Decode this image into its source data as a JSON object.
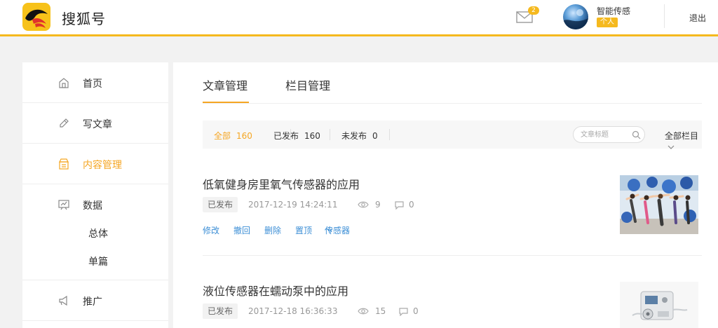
{
  "header": {
    "brand": "搜狐号",
    "mail_badge": "2",
    "user_name": "智能传感",
    "user_tag": "个人",
    "logout": "退出",
    "accent_color": "#f5b91e"
  },
  "sidebar": {
    "items": [
      {
        "label": "首页",
        "icon": "home-icon"
      },
      {
        "label": "写文章",
        "icon": "pencil-icon"
      },
      {
        "label": "内容管理",
        "icon": "content-box-icon",
        "active": true
      },
      {
        "label": "数据",
        "icon": "chart-board-icon",
        "children": [
          "总体",
          "单篇"
        ]
      },
      {
        "label": "推广",
        "icon": "megaphone-icon"
      }
    ]
  },
  "main": {
    "tabs": [
      "文章管理",
      "栏目管理"
    ],
    "active_tab": "文章管理",
    "filters": [
      {
        "label": "全部",
        "count": "160",
        "active": true
      },
      {
        "label": "已发布",
        "count": "160"
      },
      {
        "label": "未发布",
        "count": "0"
      }
    ],
    "search_placeholder": "文章标题",
    "column_select": "全部栏目",
    "articles": [
      {
        "title": "低氧健身房里氧气传感器的应用",
        "status": "已发布",
        "time": "2017-12-19 14:24:11",
        "views": "9",
        "comments": "0",
        "actions": [
          "修改",
          "撤回",
          "删除",
          "置顶",
          "传感器"
        ],
        "thumb": "fitness-class-photo"
      },
      {
        "title": "液位传感器在蠕动泵中的应用",
        "status": "已发布",
        "time": "2017-12-18 16:36:33",
        "views": "15",
        "comments": "0",
        "thumb": "peristaltic-pump-photo"
      }
    ]
  }
}
